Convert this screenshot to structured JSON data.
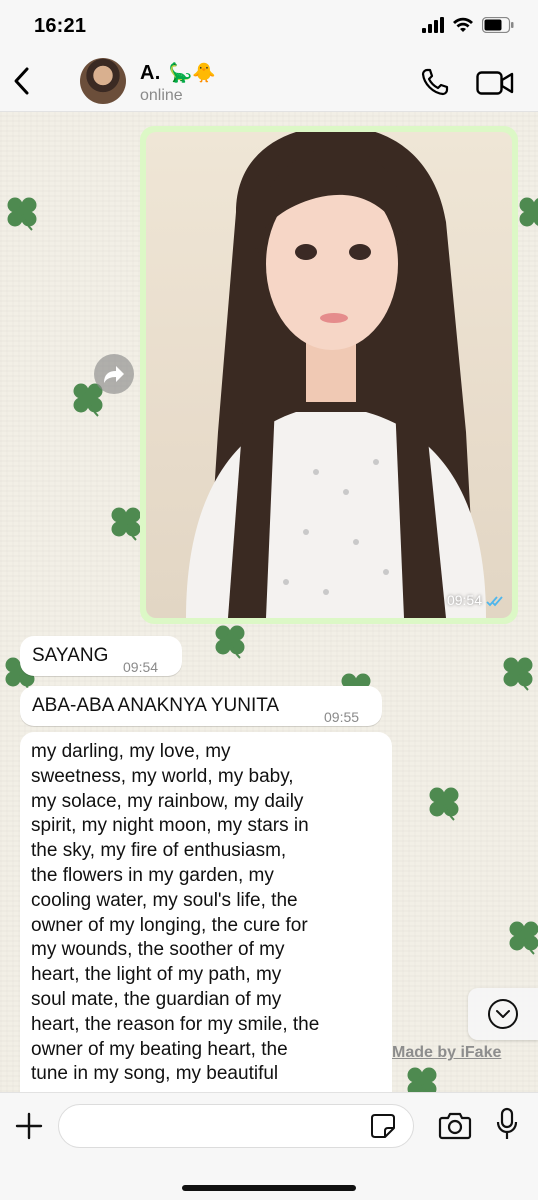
{
  "status_bar": {
    "time": "16:21",
    "icons": [
      "signal-icon",
      "wifi-icon",
      "battery-icon"
    ]
  },
  "header": {
    "contact_name": "A.",
    "contact_emojis": "🦕🐥",
    "contact_status": "online",
    "icons": [
      "back-chevron-icon",
      "phone-icon",
      "video-camera-icon"
    ]
  },
  "messages": [
    {
      "type": "image",
      "time": "09:54",
      "status": "read"
    },
    {
      "type": "text",
      "text": "SAYANG",
      "time": "09:54"
    },
    {
      "type": "text",
      "text": "ABA-ABA ANAKNYA YUNITA",
      "time": "09:55"
    },
    {
      "type": "text",
      "lines": [
        "my darling, my love, my",
        "sweetness, my world, my baby,",
        "my solace, my rainbow, my daily",
        "spirit, my night moon, my stars in",
        "the sky, my fire of enthusiasm,",
        "the flowers in my garden, my",
        "cooling water, my soul's life, the",
        "owner of my longing, the cure for",
        "my wounds, the soother of my",
        "heart, the light of my path, my",
        "soul mate, the guardian of my",
        "heart, the reason for my smile, the",
        "owner of my beating heart, the",
        "tune in my song, my beautiful"
      ]
    }
  ],
  "watermark": "Made by iFake",
  "input": {
    "placeholder": "",
    "value": ""
  },
  "colors": {
    "outgoing_bubble": "#dcf8c6",
    "incoming_bubble": "#ffffff",
    "clover": "#4e8a50",
    "read_ticks": "#4fb6ec"
  }
}
